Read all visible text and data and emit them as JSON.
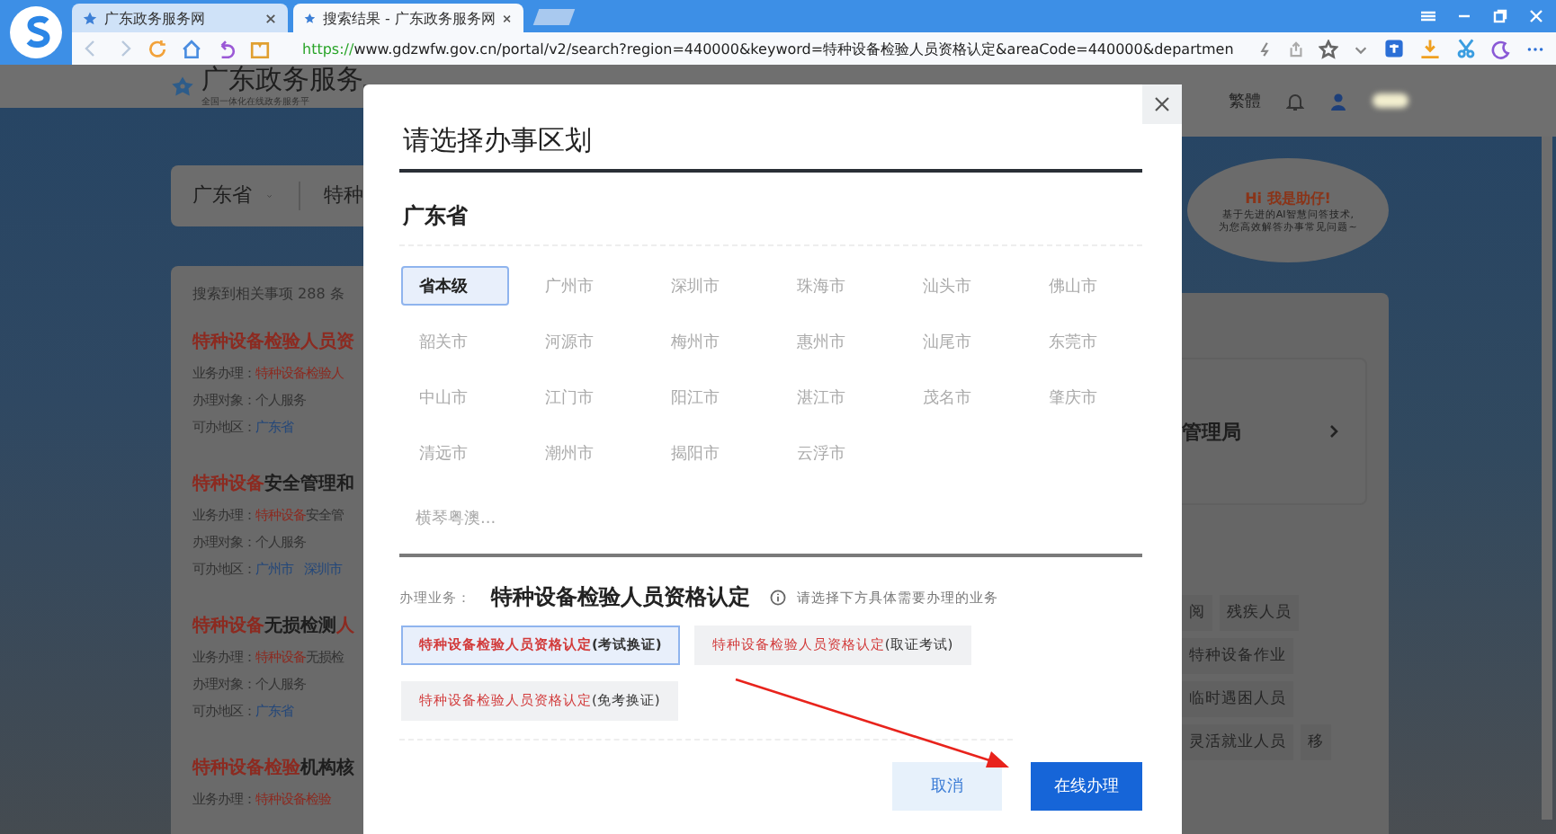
{
  "browser": {
    "tabs": [
      {
        "title": "广东政务服务网",
        "selected": false
      },
      {
        "title": "搜索结果 - 广东政务服务网",
        "selected": true
      }
    ],
    "url_scheme": "https://",
    "url_rest": "www.gdzwfw.gov.cn/portal/v2/search?region=440000&keyword=特种设备检验人员资格认定&areaCode=440000&departmen"
  },
  "site": {
    "logo_title": "广东政务服务",
    "logo_subtitle": "全国一体化在线政务服务平",
    "region_dropdown": "广东省",
    "search_scope": "特种",
    "result_count": "搜索到相关事项 288 条",
    "results": [
      {
        "title": [
          {
            "text": "特种设备检验人员资",
            "highlight": true
          }
        ],
        "rows": [
          {
            "kind": "parts",
            "label": "业务办理：",
            "parts": [
              {
                "text": "特种设备检验人",
                "highlight": true
              }
            ]
          },
          {
            "kind": "text",
            "label": "办理对象：",
            "value": "个人服务"
          },
          {
            "kind": "links",
            "label": "可办地区：",
            "links": [
              "广东省"
            ]
          }
        ]
      },
      {
        "title": [
          {
            "text": "特种设备",
            "highlight": true
          },
          {
            "text": "安全管理和",
            "highlight": false
          }
        ],
        "rows": [
          {
            "kind": "parts",
            "label": "业务办理：",
            "parts": [
              {
                "text": "特种设备",
                "highlight": true
              },
              {
                "text": "安全管",
                "highlight": false
              }
            ]
          },
          {
            "kind": "text",
            "label": "办理对象：",
            "value": "个人服务"
          },
          {
            "kind": "links",
            "label": "可办地区：",
            "links": [
              "广州市",
              "深圳市"
            ]
          }
        ]
      },
      {
        "title": [
          {
            "text": "特种设备",
            "highlight": true
          },
          {
            "text": "无损检测",
            "highlight": false
          },
          {
            "text": "人",
            "highlight": true
          }
        ],
        "rows": [
          {
            "kind": "parts",
            "label": "业务办理：",
            "parts": [
              {
                "text": "特种设备",
                "highlight": true
              },
              {
                "text": "无损检",
                "highlight": false
              }
            ]
          },
          {
            "kind": "text",
            "label": "办理对象：",
            "value": "个人服务"
          },
          {
            "kind": "links",
            "label": "可办地区：",
            "links": [
              "广东省"
            ]
          }
        ]
      },
      {
        "title": [
          {
            "text": "特种设备检验",
            "highlight": true
          },
          {
            "text": "机构核",
            "highlight": false
          }
        ],
        "rows": [
          {
            "kind": "parts",
            "label": "业务办理：",
            "parts": [
              {
                "text": "特种设备检验",
                "highlight": true
              }
            ]
          }
        ]
      }
    ],
    "header_link": "繁體",
    "assistant": {
      "title": "Hi 我是助仔!",
      "lines": [
        "基于先进的AI智慧问答技术,",
        "为您高效解答办事常见问题~"
      ]
    },
    "department": "管理局",
    "tags": [
      "阅",
      "残疾人员",
      "特种设备作业",
      "临时遇困人员",
      "灵活就业人员",
      "移"
    ]
  },
  "dialog": {
    "title": "请选择办事区划",
    "province": "广东省",
    "regions": [
      {
        "name": "省本级",
        "selected": true
      },
      {
        "name": "广州市",
        "selected": false
      },
      {
        "name": "深圳市",
        "selected": false
      },
      {
        "name": "珠海市",
        "selected": false
      },
      {
        "name": "汕头市",
        "selected": false
      },
      {
        "name": "佛山市",
        "selected": false
      },
      {
        "name": "韶关市",
        "selected": false
      },
      {
        "name": "河源市",
        "selected": false
      },
      {
        "name": "梅州市",
        "selected": false
      },
      {
        "name": "惠州市",
        "selected": false
      },
      {
        "name": "汕尾市",
        "selected": false
      },
      {
        "name": "东莞市",
        "selected": false
      },
      {
        "name": "中山市",
        "selected": false
      },
      {
        "name": "江门市",
        "selected": false
      },
      {
        "name": "阳江市",
        "selected": false
      },
      {
        "name": "湛江市",
        "selected": false
      },
      {
        "name": "茂名市",
        "selected": false
      },
      {
        "name": "肇庆市",
        "selected": false
      },
      {
        "name": "清远市",
        "selected": false
      },
      {
        "name": "潮州市",
        "selected": false
      },
      {
        "name": "揭阳市",
        "selected": false
      },
      {
        "name": "云浮市",
        "selected": false
      }
    ],
    "more_regions": "横琴粤澳...",
    "business_label": "办理业务：",
    "business_name": "特种设备检验人员资格认定",
    "hint": "请选择下方具体需要办理的业务",
    "options": [
      {
        "name": "特种设备检验人员资格认定",
        "suffix": "(考试换证)",
        "selected": true
      },
      {
        "name": "特种设备检验人员资格认定",
        "suffix": "(取证考试)",
        "selected": false
      },
      {
        "name": "特种设备检验人员资格认定",
        "suffix": "(免考换证)",
        "selected": false
      }
    ],
    "buttons": [
      {
        "label": "取消",
        "kind": "secondary"
      },
      {
        "label": "在线办理",
        "kind": "primary"
      }
    ]
  }
}
